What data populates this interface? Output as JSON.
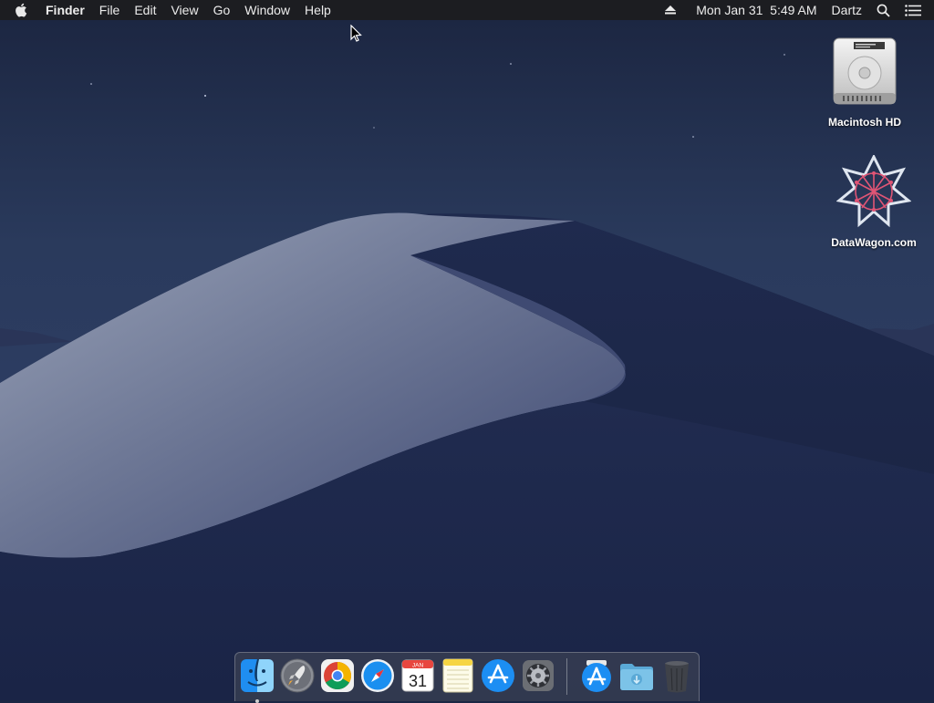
{
  "menubar": {
    "apple_icon": "apple-logo-icon",
    "app_name": "Finder",
    "menus": [
      "File",
      "Edit",
      "View",
      "Go",
      "Window",
      "Help"
    ],
    "status": {
      "eject_icon": "eject-icon",
      "clock": "Mon Jan 31  5:49 AM",
      "user": "Dartz",
      "search_icon": "spotlight-search-icon",
      "notification_icon": "notification-center-icon"
    }
  },
  "desktop": {
    "icons": [
      {
        "label": "Macintosh HD",
        "icon": "hard-drive-icon"
      },
      {
        "label": "DataWagon.com",
        "icon": "network-volume-icon"
      }
    ]
  },
  "dock": {
    "items": [
      {
        "name": "Finder",
        "icon": "finder-icon",
        "running": true
      },
      {
        "name": "Launchpad",
        "icon": "launchpad-icon"
      },
      {
        "name": "Google Chrome",
        "icon": "chrome-icon"
      },
      {
        "name": "Safari",
        "icon": "safari-icon"
      },
      {
        "name": "Calendar",
        "icon": "calendar-icon",
        "month": "JAN",
        "day": "31"
      },
      {
        "name": "Notes",
        "icon": "notes-icon"
      },
      {
        "name": "App Store",
        "icon": "app-store-icon"
      },
      {
        "name": "System Preferences",
        "icon": "system-preferences-icon"
      },
      {
        "name": "Applications",
        "icon": "applications-stack-icon"
      },
      {
        "name": "Downloads",
        "icon": "downloads-folder-icon"
      },
      {
        "name": "Trash",
        "icon": "trash-icon"
      }
    ]
  },
  "colors": {
    "menubar": "#1c1c1e",
    "sky_top": "#1b2744",
    "dune_light": "#8a94ac",
    "dune_shadow": "#1a2447"
  }
}
